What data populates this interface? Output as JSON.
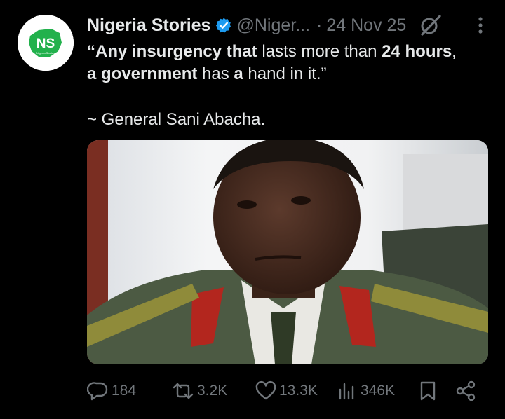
{
  "author": {
    "name": "Nigeria Stories",
    "handle": "@Niger...",
    "separator": "·",
    "date": "24 Nov 25",
    "avatar_text": "NS",
    "avatar_subtext": "Nigeria Stories"
  },
  "tweet": {
    "segments": [
      {
        "text": "“Any insurgency that",
        "bold": true
      },
      {
        "text": " lasts more than ",
        "bold": false
      },
      {
        "text": "24 hours",
        "bold": true
      },
      {
        "text": ", ",
        "bold": false
      },
      {
        "text": "a government",
        "bold": true
      },
      {
        "text": " has ",
        "bold": false
      },
      {
        "text": "a",
        "bold": true
      },
      {
        "text": " hand in it.”",
        "bold": false
      }
    ],
    "attribution": "~  General Sani Abacha."
  },
  "actions": {
    "replies": "184",
    "reposts": "3.2K",
    "likes": "13.3K",
    "views": "346K"
  },
  "colors": {
    "background": "#000000",
    "text": "#e7e9ea",
    "muted": "#71767b",
    "verified": "#1d9bf0",
    "logo_green": "#22b14c"
  }
}
